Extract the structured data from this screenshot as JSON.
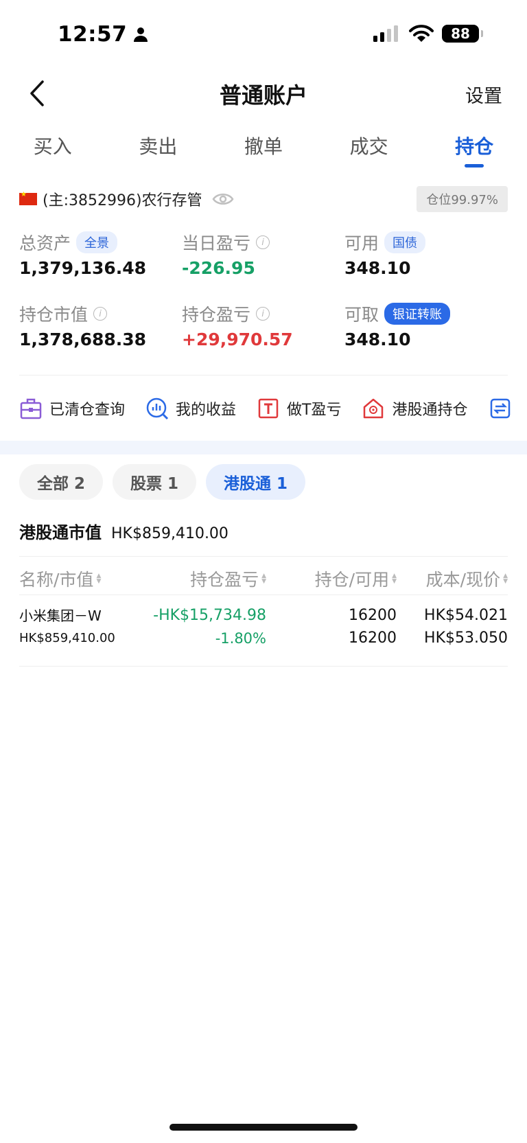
{
  "status_bar": {
    "time": "12:57",
    "battery": "88"
  },
  "nav": {
    "title": "普通账户",
    "settings": "设置"
  },
  "tabs": [
    {
      "label": "买入"
    },
    {
      "label": "卖出"
    },
    {
      "label": "撤单"
    },
    {
      "label": "成交"
    },
    {
      "label": "持仓",
      "active": true
    }
  ],
  "account": {
    "text": "(主:3852996)农行存管",
    "position_ratio": "仓位99.97%"
  },
  "metrics": {
    "total_assets": {
      "label": "总资产",
      "pill": "全景",
      "value": "1,379,136.48"
    },
    "daily_pnl": {
      "label": "当日盈亏",
      "value": "-226.95"
    },
    "available": {
      "label": "可用",
      "pill": "国债",
      "value": "348.10"
    },
    "position_value": {
      "label": "持仓市值",
      "value": "1,378,688.38"
    },
    "position_pnl": {
      "label": "持仓盈亏",
      "value": "+29,970.57"
    },
    "withdrawable": {
      "label": "可取",
      "pill": "银证转账",
      "value": "348.10"
    }
  },
  "quick_links": [
    {
      "label": "已清仓查询",
      "icon": "briefcase-icon"
    },
    {
      "label": "我的收益",
      "icon": "chart-search-icon"
    },
    {
      "label": "做T盈亏",
      "icon": "t-box-icon"
    },
    {
      "label": "港股通持仓",
      "icon": "hk-house-icon"
    }
  ],
  "filters": [
    {
      "label": "全部 2"
    },
    {
      "label": "股票 1"
    },
    {
      "label": "港股通 1",
      "active": true
    }
  ],
  "hk_section": {
    "title": "港股通市值",
    "value": "HK$859,410.00"
  },
  "table": {
    "headers": [
      "名称/市值",
      "持仓盈亏",
      "持仓/可用",
      "成本/现价"
    ],
    "rows": [
      {
        "name": "小米集团－W",
        "market_value": "HK$859,410.00",
        "pnl": "-HK$15,734.98",
        "pnl_pct": "-1.80%",
        "position": "16200",
        "available": "16200",
        "cost": "HK$54.021",
        "price": "HK$53.050"
      }
    ]
  },
  "colors": {
    "accent": "#1a5fd8",
    "gain": "#e0393b",
    "loss": "#16a066"
  }
}
